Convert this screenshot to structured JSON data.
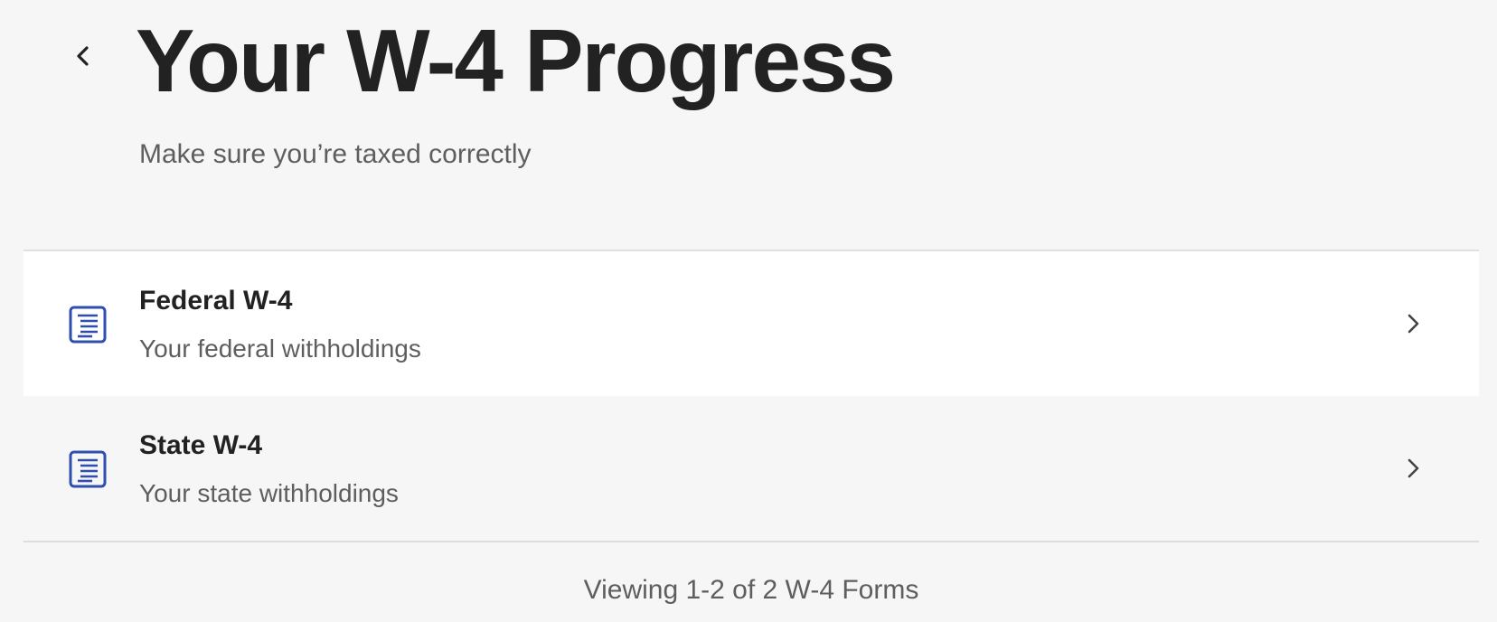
{
  "header": {
    "back_icon": "chevron-left-icon",
    "title": "Your W-4 Progress",
    "subtitle": "Make sure you’re taxed correctly"
  },
  "forms": [
    {
      "icon": "document-icon",
      "title": "Federal W-4",
      "description": "Your federal withholdings",
      "selected": true
    },
    {
      "icon": "document-icon",
      "title": "State W-4",
      "description": "Your state withholdings",
      "selected": false
    }
  ],
  "pagination": {
    "status": "Viewing 1-2 of 2 W-4 Forms"
  },
  "colors": {
    "background": "#f6f6f6",
    "row_selected": "#ffffff",
    "icon_accent": "#2f4fae",
    "text_primary": "#222222",
    "text_secondary": "#5e5e5e"
  }
}
